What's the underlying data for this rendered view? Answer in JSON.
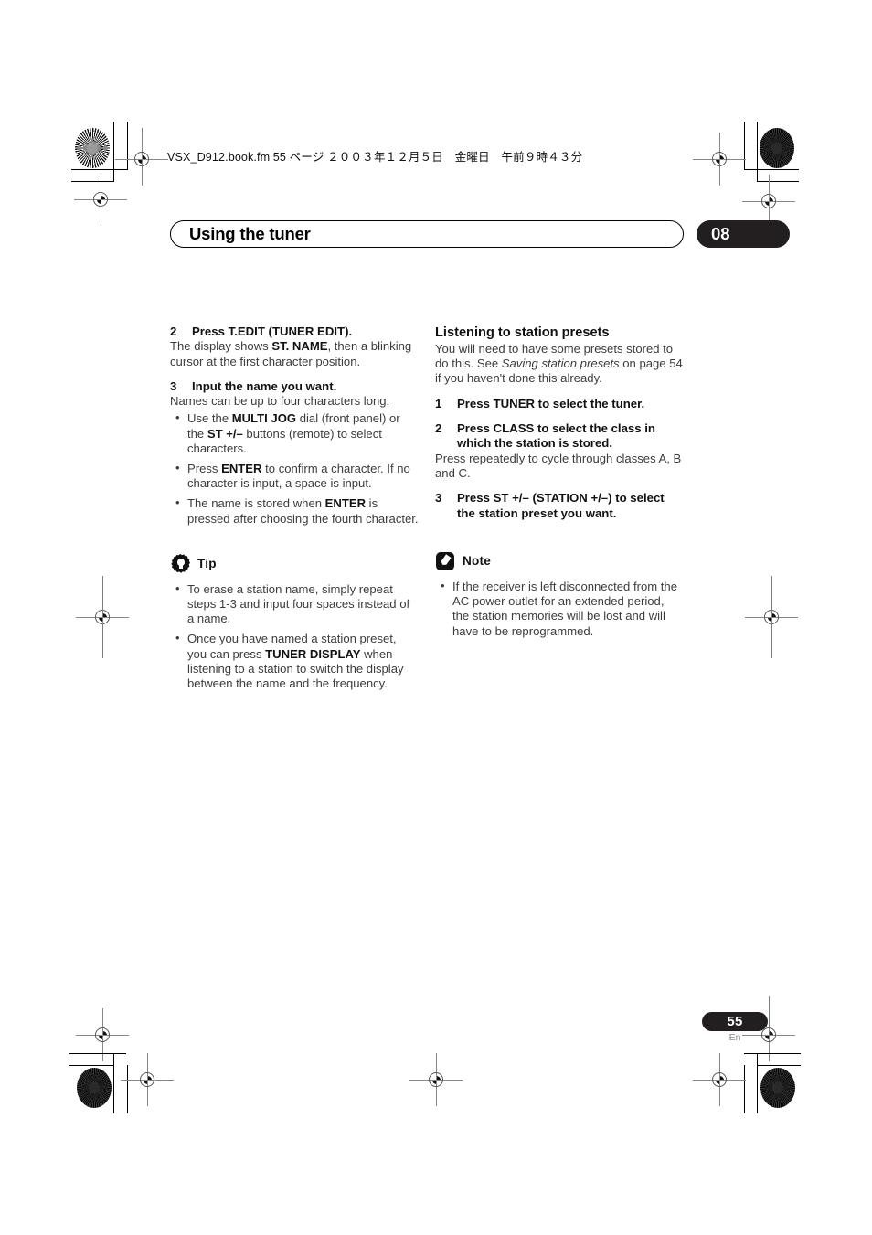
{
  "print_header": {
    "file_line": "VSX_D912.book.fm  55 ページ  ２００３年１２月５日　金曜日　午前９時４３分"
  },
  "header": {
    "title": "Using the tuner",
    "chapter": "08"
  },
  "left_column": {
    "step2": {
      "number": "2",
      "heading": "Press T.EDIT (TUNER EDIT).",
      "body_pre": "The display shows ",
      "body_bold": "ST. NAME",
      "body_post": ", then a blinking cursor at the first character position."
    },
    "step3": {
      "number": "3",
      "heading": "Input the name you want.",
      "body": "Names can be up to four characters long.",
      "bullets": [
        {
          "pre": "Use the ",
          "bold1": "MULTI JOG",
          "mid": " dial (front panel) or the ",
          "bold2": "ST +/–",
          "post": " buttons (remote) to select characters."
        },
        {
          "pre": "Press ",
          "bold1": "ENTER",
          "post": " to confirm a character. If no character is input, a space is input."
        },
        {
          "pre": "The name is stored when ",
          "bold1": "ENTER",
          "post": " is pressed after choosing the fourth character."
        }
      ]
    },
    "tip": {
      "icon": "gear-lightbulb-icon",
      "label": "Tip",
      "bullets": [
        {
          "pre": "To erase a station name, simply repeat steps 1-3 and input four spaces instead of a name."
        },
        {
          "pre": "Once you have named a station preset, you can press ",
          "bold1": "TUNER DISPLAY",
          "post": " when listening to a station to switch the display between the name and the frequency."
        }
      ]
    }
  },
  "right_column": {
    "section_heading": "Listening to station presets",
    "intro_pre": "You will need to have some presets stored to do this. See ",
    "intro_italic": "Saving station presets",
    "intro_post": " on page 54 if you haven't done this already.",
    "step1": {
      "number": "1",
      "heading": "Press TUNER to select the tuner."
    },
    "step2": {
      "number": "2",
      "heading": "Press CLASS to select the class in which the station is stored.",
      "body": "Press repeatedly to cycle through classes A, B and C."
    },
    "step3": {
      "number": "3",
      "heading": "Press ST +/– (STATION +/–) to select the station preset you want."
    },
    "note": {
      "icon": "pencil-icon",
      "label": "Note",
      "bullets": [
        {
          "pre": "If the receiver is left disconnected from the AC power outlet for an extended period, the station memories will be lost and will have to be reprogrammed."
        }
      ]
    }
  },
  "footer": {
    "page_number": "55",
    "language": "En"
  },
  "colors": {
    "badge_bg": "#231f20",
    "body_text": "#3c3c3c",
    "heading_text": "#111111"
  }
}
